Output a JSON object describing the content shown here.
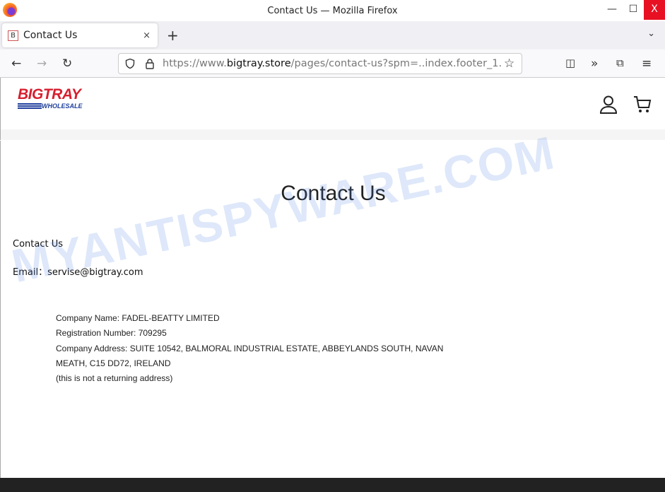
{
  "window": {
    "title": "Contact Us — Mozilla Firefox",
    "minimize": "—",
    "maximize": "☐",
    "close": "X"
  },
  "tab": {
    "favicon": "B",
    "label": "Contact Us",
    "close": "×",
    "new_tab": "+",
    "list_all": "⌄"
  },
  "nav": {
    "back": "←",
    "forward": "→",
    "reload": "↻",
    "url_prefix": "https://www.",
    "url_domain": "bigtray.store",
    "url_path": "/pages/contact-us?spm=..index.footer_1.",
    "pocket": "◫",
    "overflow": "»",
    "extensions": "⧉",
    "menu": "≡",
    "star": "☆"
  },
  "site": {
    "logo_text": "BIGTRAY",
    "logo_sub": "WHOLESALE"
  },
  "page": {
    "title": "Contact Us",
    "subtitle": "Contact Us",
    "email": "Email：servise@bigtray.com",
    "company_lines": [
      "Company Name: FADEL-BEATTY LIMITED",
      "Registration Number: 709295",
      "Company Address: SUITE 10542, BALMORAL INDUSTRIAL ESTATE, ABBEYLANDS SOUTH, NAVAN",
      "MEATH, C15 DD72, IRELAND",
      "(this is not a returning address)"
    ]
  },
  "watermark": "MYANTISPYWARE.COM"
}
